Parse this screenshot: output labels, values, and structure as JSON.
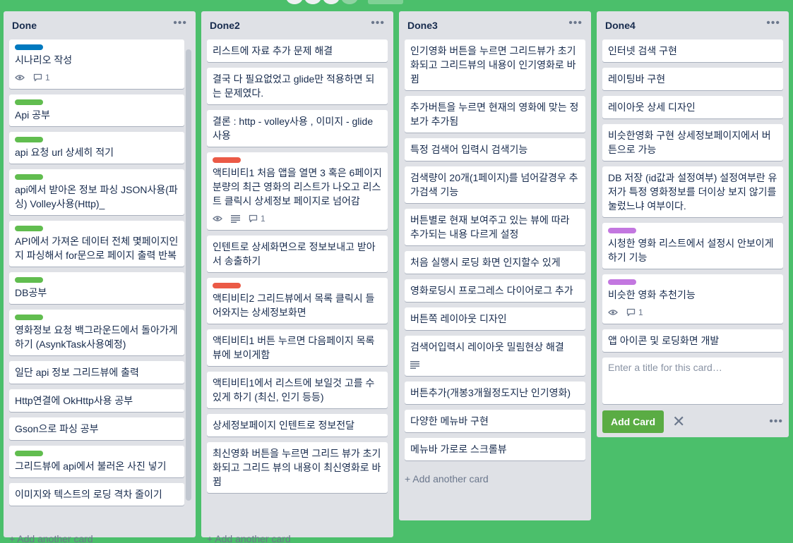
{
  "colors": {
    "board_bg": "#4bbf6b",
    "label_blue": "#0079bf",
    "label_green": "#61bd4f",
    "label_red": "#eb5a46",
    "label_purple": "#c377e0",
    "add_button": "#5aac44"
  },
  "lists": [
    {
      "title": "Done",
      "add_card": "+ Add another card",
      "cards": [
        {
          "text": "시나리오 작성",
          "label": "blue",
          "badges": {
            "watch": true,
            "comments": "1"
          }
        },
        {
          "text": "Api 공부",
          "label": "green"
        },
        {
          "text": "api 요청 url 상세히 적기",
          "label": "green"
        },
        {
          "text": "api에서 받아온 정보 파싱 JSON사용(파싱) Volley사용(Http)_",
          "label": "green"
        },
        {
          "text": "API에서 가져온 데이터 전체 몇페이지인지 파싱해서 for문으로 페이지 출력 반복",
          "label": "green"
        },
        {
          "text": "DB공부",
          "label": "green"
        },
        {
          "text": "영화정보 요청 백그라운드에서 돌아가게 하기 (AsynkTask사용예정)",
          "label": "green"
        },
        {
          "text": "일단 api 정보 그리드뷰에 출력"
        },
        {
          "text": "Http연결에 OkHttp사용 공부"
        },
        {
          "text": "Gson으로 파싱 공부"
        },
        {
          "text": "그리드뷰에 api에서 불러온 사진 넣기",
          "label": "green"
        },
        {
          "text": "이미지와 텍스트의 로딩 격차 줄이기"
        }
      ]
    },
    {
      "title": "Done2",
      "add_card": "+ Add another card",
      "cards": [
        {
          "text": "리스트에 자료 추가 문제 해결"
        },
        {
          "text": "결국 다 필요없었고 glide만 적용하면 되는 문제였다."
        },
        {
          "text": "결론 : http - volley사용 , 이미지 - glide 사용"
        },
        {
          "text": "액티비티1 처음 앱을 열면 3 혹은 6페이지 분량의 최근 영화의 리스트가 나오고 리스트 클릭시 상세정보 페이지로 넘어감",
          "label": "red",
          "badges": {
            "watch": true,
            "description": true,
            "comments": "1"
          }
        },
        {
          "text": "인텐트로 상세화면으로 정보보내고 받아서 송출하기"
        },
        {
          "text": "액티비티2 그리드뷰에서 목록 클릭시 들어와지는 상세정보화면",
          "label": "red"
        },
        {
          "text": "액티비티1 버튼 누르면 다음페이지 목록 뷰에 보이게함"
        },
        {
          "text": "액티비티1에서 리스트에 보일것 고를 수 있게 하기 (최신, 인기 등등)"
        },
        {
          "text": "상세정보페이지 인텐트로 정보전달"
        },
        {
          "text": "최신영화 버튼을 누르면 그리드 뷰가 초기화되고 그리드 뷰의 내용이 최신영화로 바뀜"
        }
      ]
    },
    {
      "title": "Done3",
      "add_card": "+ Add another card",
      "cards": [
        {
          "text": "인기영화 버튼을 누르면 그리드뷰가 초기화되고 그리드뷰의 내용이 인기영화로 바뀜"
        },
        {
          "text": "추가버튼을 누르면 현재의 영화에 맞는 정보가 추가됨"
        },
        {
          "text": "특정 검색어 입력시 검색기능"
        },
        {
          "text": "검색량이 20개(1페이지)를 넘어갈경우 추가검색 기능"
        },
        {
          "text": "버튼별로 현재 보여주고 있는 뷰에 따라 추가되는 내용 다르게 설정"
        },
        {
          "text": "처음 실행시 로딩 화면 인지할수 있게"
        },
        {
          "text": "영화로딩시 프로그레스 다이어로그 추가"
        },
        {
          "text": "버튼쪽 레이아웃 디자인"
        },
        {
          "text": "검색어입력시 레이아웃 밀림현상 해결",
          "badges": {
            "description": true
          }
        },
        {
          "text": "버튼추가(개봉3개월정도지난 인기영화)"
        },
        {
          "text": "다양한 메뉴바 구현"
        },
        {
          "text": "메뉴바 가로로 스크롤뷰"
        }
      ]
    },
    {
      "title": "Done4",
      "composer_placeholder": "Enter a title for this card…",
      "add_button": "Add Card",
      "cards": [
        {
          "text": "인터넷 검색 구현"
        },
        {
          "text": "레이팅바 구현"
        },
        {
          "text": "레이아웃 상세 디자인"
        },
        {
          "text": "비슷한영화 구현 상세정보페이지에서 버튼으로 가능"
        },
        {
          "text": "DB 저장 (id값과 설정여부) 설정여부란 유저가 특정 영화정보를 더이상 보지 않기를 눌렀느냐 여부이다."
        },
        {
          "text": "시청한 영화 리스트에서 설정시 안보이게하기 기능",
          "label": "purple"
        },
        {
          "text": "비슷한 영화 추천기능",
          "label": "purple",
          "badges": {
            "watch": true,
            "comments": "1"
          }
        },
        {
          "text": "앱 아이콘 및 로딩화면 개발"
        }
      ]
    }
  ]
}
